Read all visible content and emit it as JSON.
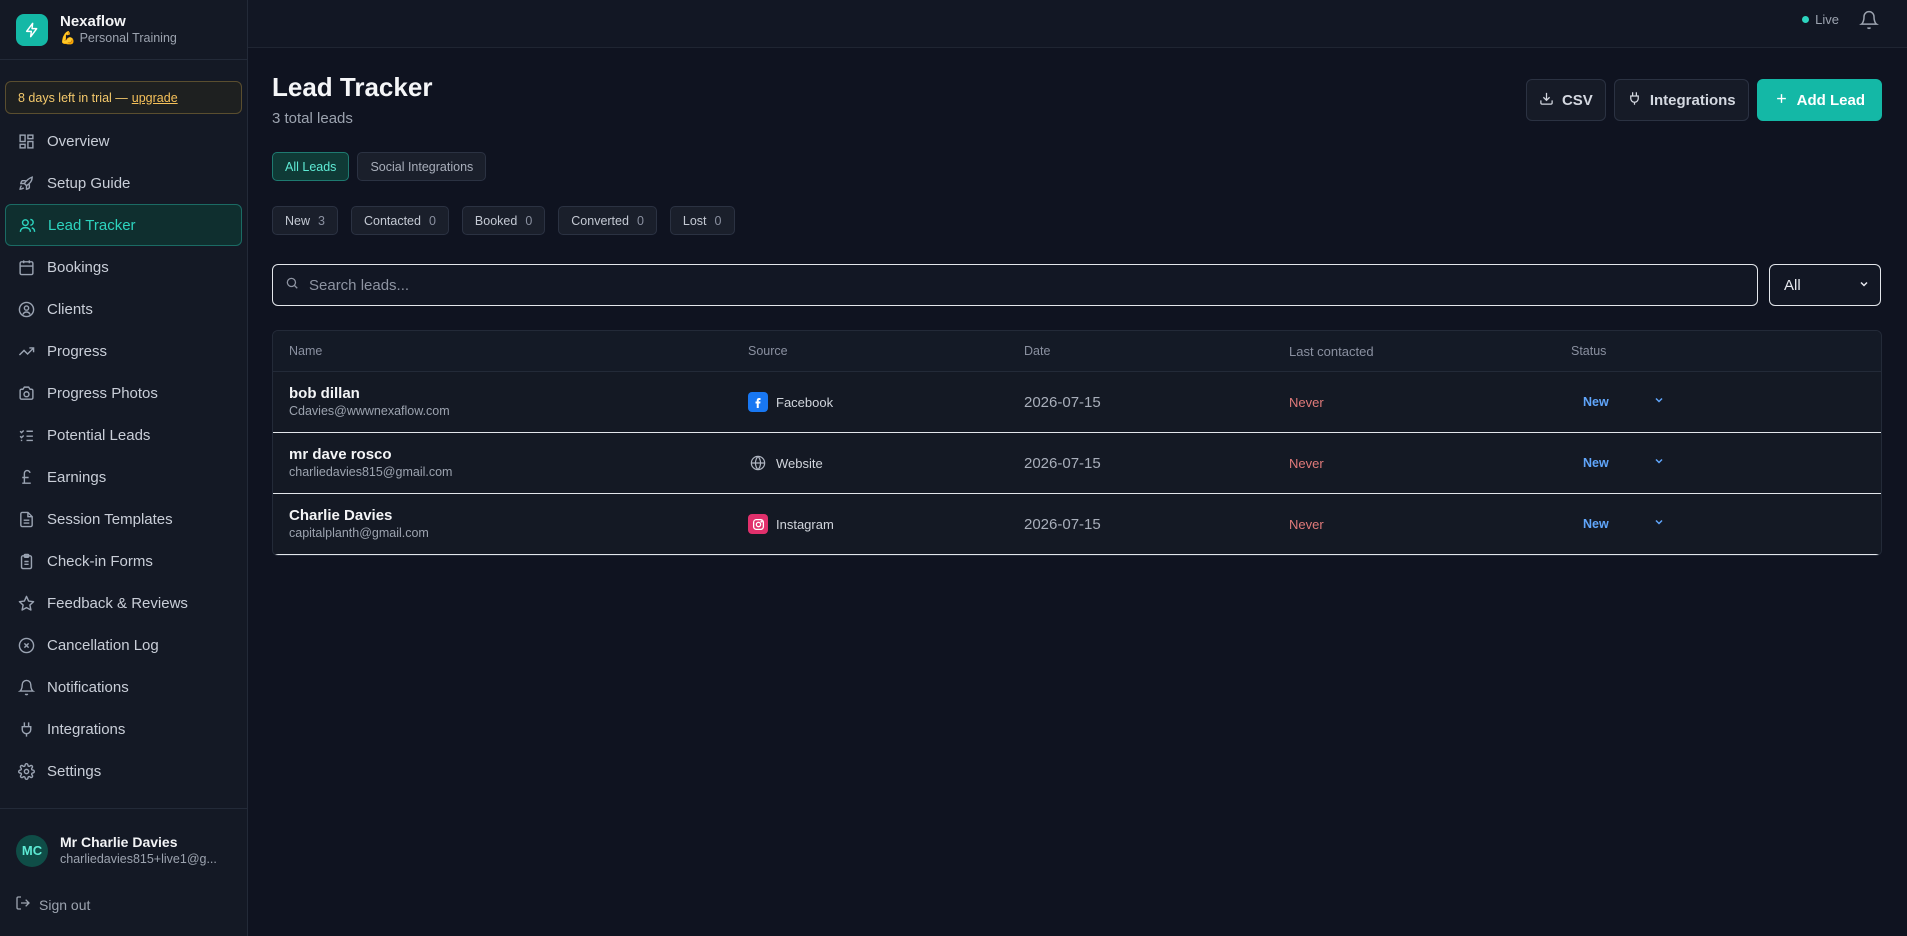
{
  "brand": {
    "name": "Nexaflow",
    "subtitle": "Personal Training"
  },
  "trial": {
    "text": "8 days left in trial —",
    "link": "upgrade"
  },
  "sidebar": {
    "items": [
      {
        "label": "Overview",
        "icon": "grid-icon"
      },
      {
        "label": "Setup Guide",
        "icon": "rocket-icon"
      },
      {
        "label": "Lead Tracker",
        "icon": "users-icon",
        "active": true
      },
      {
        "label": "Bookings",
        "icon": "calendar-icon"
      },
      {
        "label": "Clients",
        "icon": "user-circle-icon"
      },
      {
        "label": "Progress",
        "icon": "trending-up-icon"
      },
      {
        "label": "Progress Photos",
        "icon": "camera-icon"
      },
      {
        "label": "Potential Leads",
        "icon": "list-checks-icon"
      },
      {
        "label": "Earnings",
        "icon": "pound-icon"
      },
      {
        "label": "Session Templates",
        "icon": "file-text-icon"
      },
      {
        "label": "Check-in Forms",
        "icon": "clipboard-icon"
      },
      {
        "label": "Feedback & Reviews",
        "icon": "star-icon"
      },
      {
        "label": "Cancellation Log",
        "icon": "x-circle-icon"
      },
      {
        "label": "Notifications",
        "icon": "bell-icon"
      },
      {
        "label": "Integrations",
        "icon": "plug-icon"
      },
      {
        "label": "Settings",
        "icon": "gear-icon"
      }
    ]
  },
  "user": {
    "initials": "MC",
    "name": "Mr Charlie Davies",
    "email": "charliedavies815+live1@g..."
  },
  "signout": "Sign out",
  "topbar": {
    "live": "Live"
  },
  "page": {
    "title": "Lead Tracker",
    "subtitle": "3 total leads",
    "csv": "CSV",
    "integrations": "Integrations",
    "add_lead": "Add Lead"
  },
  "tabs": {
    "all": "All Leads",
    "social": "Social Integrations"
  },
  "chips": [
    {
      "label": "New",
      "count": "3"
    },
    {
      "label": "Contacted",
      "count": "0"
    },
    {
      "label": "Booked",
      "count": "0"
    },
    {
      "label": "Converted",
      "count": "0"
    },
    {
      "label": "Lost",
      "count": "0"
    }
  ],
  "search": {
    "placeholder": "Search leads..."
  },
  "filter": {
    "value": "All"
  },
  "table": {
    "headers": [
      "Name",
      "Source",
      "Date",
      "Last contacted",
      "Status"
    ],
    "rows": [
      {
        "name": "bob dillan",
        "email": "Cdavies@wwwnexaflow.com",
        "source": "Facebook",
        "date": "2026-07-15",
        "last": "Never",
        "status": "New"
      },
      {
        "name": "mr dave rosco",
        "email": "charliedavies815@gmail.com",
        "source": "Website",
        "date": "2026-07-15",
        "last": "Never",
        "status": "New"
      },
      {
        "name": "Charlie Davies",
        "email": "capitalplanth@gmail.com",
        "source": "Instagram",
        "date": "2026-07-15",
        "last": "Never",
        "status": "New"
      }
    ]
  },
  "colors": {
    "accent": "#14b8a6",
    "status_new": "#60a5fa",
    "never": "#e07a7a"
  }
}
